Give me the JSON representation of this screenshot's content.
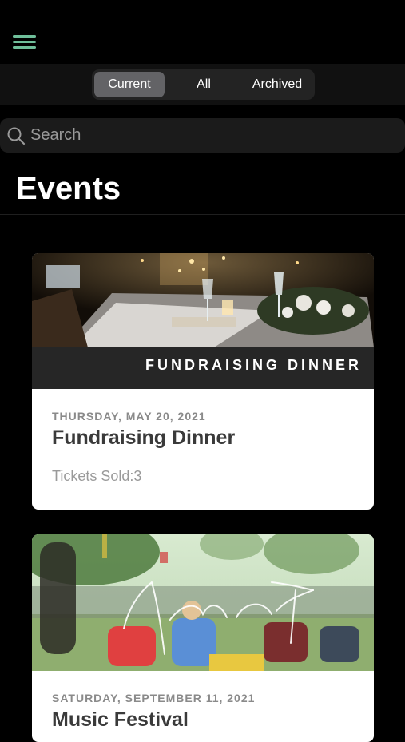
{
  "tabs": [
    {
      "label": "Current",
      "active": true
    },
    {
      "label": "All",
      "active": false
    },
    {
      "label": "Archived",
      "active": false
    }
  ],
  "search": {
    "placeholder": "Search",
    "value": ""
  },
  "page": {
    "title": "Events"
  },
  "events": [
    {
      "date": "THURSDAY, MAY 20, 2021",
      "title": "Fundraising Dinner",
      "tickets": "Tickets Sold:3",
      "banner_text": "FUNDRAISING DINNER"
    },
    {
      "date": "SATURDAY, SEPTEMBER 11, 2021",
      "title": "Music Festival",
      "banner_script": "Music Festival"
    }
  ],
  "icons": {
    "menu": "hamburger-menu-icon",
    "search": "search-icon"
  },
  "colors": {
    "accent": "#6fbf9a",
    "background": "#000000",
    "segment_active": "#636366"
  }
}
